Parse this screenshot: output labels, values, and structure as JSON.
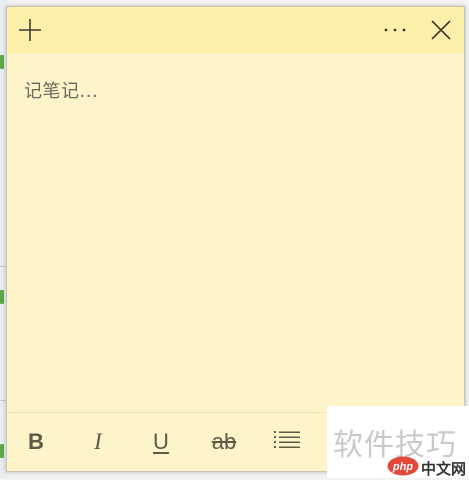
{
  "note": {
    "placeholder": "记笔记...",
    "background_color": "#fdf4c9",
    "titlebar_color": "#fcefa9"
  },
  "titlebar": {
    "add_icon": "plus-icon",
    "more_icon": "ellipsis-icon",
    "close_icon": "close-icon"
  },
  "toolbar": {
    "bold": "B",
    "italic": "I",
    "underline": "U",
    "strikethrough": "ab",
    "list_icon": "bullet-list-icon"
  },
  "watermark": {
    "text": "软件技巧",
    "logo_text": "php",
    "site": "中文网"
  }
}
